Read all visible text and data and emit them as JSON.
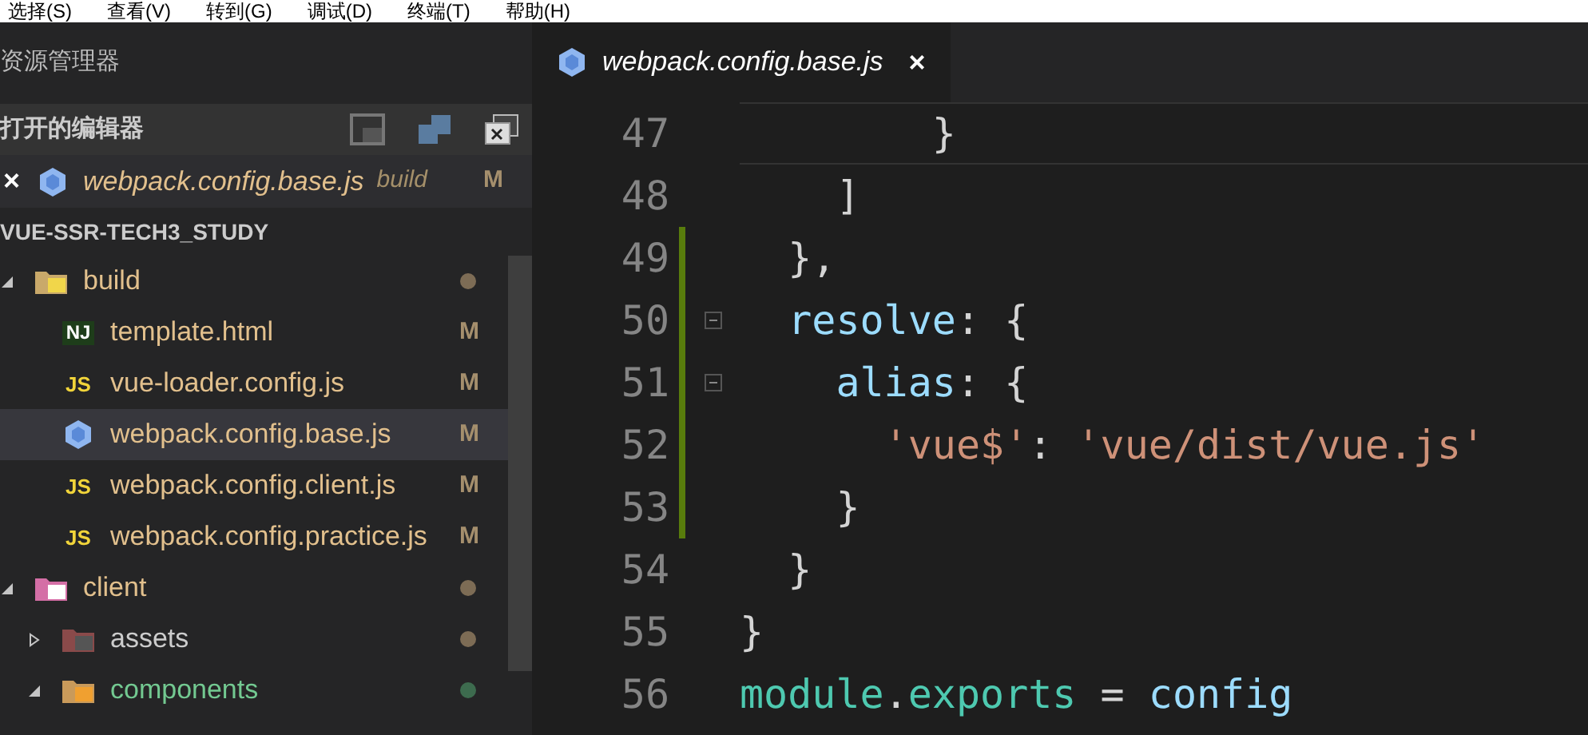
{
  "menu_bar": [
    "选择(S)",
    "查看(V)",
    "转到(G)",
    "调试(D)",
    "终端(T)",
    "帮助(H)"
  ],
  "sidebar": {
    "title": "资源管理器",
    "open_editors": {
      "title": "打开的编辑器",
      "items": [
        {
          "close": "×",
          "kind": "webpack",
          "name": "webpack.config.base.js",
          "description": "build",
          "badge": "M",
          "modified": true,
          "untracked": false
        }
      ]
    },
    "folder_title": "VUE-SSR-TECH3_STUDY",
    "tree": [
      {
        "name": "build",
        "kind": "folder-build",
        "expanded": true,
        "modified": true,
        "untracked": false,
        "color": "#7d6c55",
        "selected": false,
        "children": [
          {
            "name": "template.html",
            "kind": "nunjucks",
            "icon_label": "NJ",
            "badge": "M",
            "modified": true,
            "untracked": false,
            "selected": false
          },
          {
            "name": "vue-loader.config.js",
            "kind": "js",
            "icon_label": "JS",
            "badge": "M",
            "modified": true,
            "untracked": false,
            "selected": false
          },
          {
            "name": "webpack.config.base.js",
            "kind": "webpack",
            "badge": "M",
            "modified": true,
            "untracked": false,
            "selected": true
          },
          {
            "name": "webpack.config.client.js",
            "kind": "js",
            "icon_label": "JS",
            "badge": "M",
            "modified": true,
            "untracked": false,
            "selected": false
          },
          {
            "name": "webpack.config.practice.js",
            "kind": "js",
            "icon_label": "JS",
            "badge": "M",
            "modified": true,
            "untracked": false,
            "selected": false
          }
        ]
      },
      {
        "name": "client",
        "kind": "folder-client",
        "expanded": true,
        "modified": true,
        "untracked": false,
        "color": "#7d6c55",
        "selected": false,
        "children": [
          {
            "name": "assets",
            "kind": "folder-assets",
            "expanded": false,
            "modified": false,
            "untracked": false,
            "color": "#7d6c55",
            "selected": false
          },
          {
            "name": "components",
            "kind": "folder-components",
            "expanded": true,
            "untracked": true,
            "color": "#3d6b4e",
            "selected": false
          }
        ]
      }
    ]
  },
  "editor": {
    "tabs": [
      {
        "kind": "webpack",
        "name": "webpack.config.base.js",
        "close": "×",
        "selected": true
      }
    ],
    "lines": [
      {
        "number": "47",
        "current": true,
        "modified": false,
        "foldable": false,
        "tokens": [
          {
            "kind": "punct",
            "text": "        }"
          }
        ]
      },
      {
        "number": "48",
        "current": false,
        "modified": false,
        "foldable": false,
        "tokens": [
          {
            "kind": "punct",
            "text": "    ]"
          }
        ]
      },
      {
        "number": "49",
        "current": false,
        "modified": true,
        "foldable": false,
        "tokens": [
          {
            "kind": "punct",
            "text": "  },"
          }
        ]
      },
      {
        "number": "50",
        "current": false,
        "modified": true,
        "foldable": true,
        "tokens": [
          {
            "kind": "key",
            "text": "  resolve"
          },
          {
            "kind": "punct",
            "text": ": {"
          }
        ]
      },
      {
        "number": "51",
        "current": false,
        "modified": true,
        "foldable": true,
        "tokens": [
          {
            "kind": "key",
            "text": "    alias"
          },
          {
            "kind": "punct",
            "text": ": {"
          }
        ]
      },
      {
        "number": "52",
        "current": false,
        "modified": true,
        "foldable": false,
        "tokens": [
          {
            "kind": "string",
            "text": "      'vue$'"
          },
          {
            "kind": "punct",
            "text": ": "
          },
          {
            "kind": "string",
            "text": "'vue/dist/vue.js'"
          }
        ]
      },
      {
        "number": "53",
        "current": false,
        "modified": true,
        "foldable": false,
        "tokens": [
          {
            "kind": "punct",
            "text": "    }"
          }
        ]
      },
      {
        "number": "54",
        "current": false,
        "modified": false,
        "foldable": false,
        "tokens": [
          {
            "kind": "punct",
            "text": "  }"
          }
        ]
      },
      {
        "number": "55",
        "current": false,
        "modified": false,
        "foldable": false,
        "tokens": [
          {
            "kind": "punct",
            "text": "}"
          }
        ]
      },
      {
        "number": "56",
        "current": false,
        "modified": false,
        "foldable": false,
        "tokens": [
          {
            "kind": "module",
            "text": "module"
          },
          {
            "kind": "punct",
            "text": "."
          },
          {
            "kind": "module",
            "text": "exports"
          },
          {
            "kind": "punct",
            "text": " = "
          },
          {
            "kind": "key",
            "text": "config"
          }
        ]
      }
    ]
  }
}
